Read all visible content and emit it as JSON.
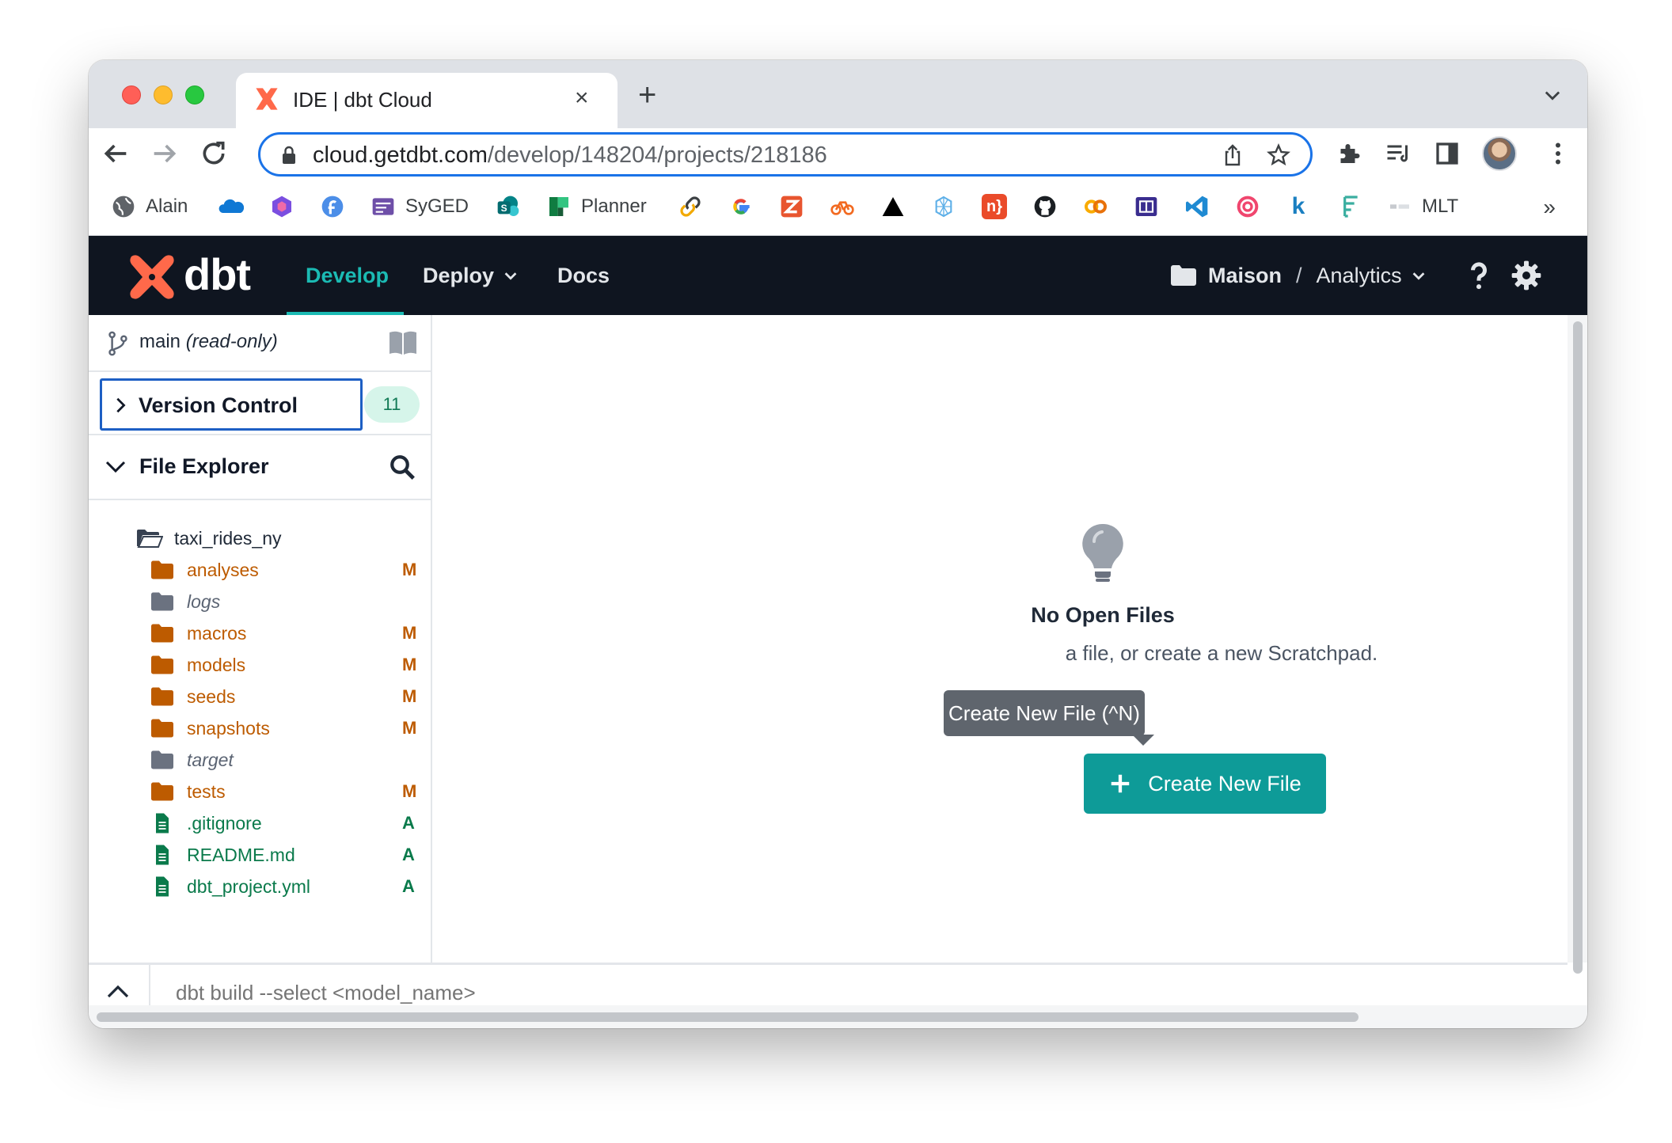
{
  "browser": {
    "tab_title": "IDE | dbt Cloud",
    "tab_close": "×",
    "new_tab": "+",
    "url_host": "cloud.getdbt.com",
    "url_path": "/develop/148204/projects/218186"
  },
  "bookmarks": [
    {
      "label": "Alain",
      "icon": "globe-icon"
    },
    {
      "label": "",
      "icon": "onedrive-icon"
    },
    {
      "label": "",
      "icon": "office-icon"
    },
    {
      "label": "",
      "icon": "f-icon"
    },
    {
      "label": "SyGED",
      "icon": "syged-icon"
    },
    {
      "label": "",
      "icon": "sharepoint-icon"
    },
    {
      "label": "Planner",
      "icon": "planner-icon"
    },
    {
      "label": "",
      "icon": "link-icon"
    },
    {
      "label": "",
      "icon": "google-icon"
    },
    {
      "label": "",
      "icon": "zotero-icon"
    },
    {
      "label": "",
      "icon": "bike-icon"
    },
    {
      "label": "",
      "icon": "triangle-icon"
    },
    {
      "label": "",
      "icon": "brain-icon"
    },
    {
      "label": "",
      "icon": "n-icon"
    },
    {
      "label": "",
      "icon": "github-icon"
    },
    {
      "label": "",
      "icon": "colab-icon"
    },
    {
      "label": "",
      "icon": "app-icon"
    },
    {
      "label": "",
      "icon": "vscode-icon"
    },
    {
      "label": "",
      "icon": "target-icon"
    },
    {
      "label": "",
      "icon": "k-icon"
    },
    {
      "label": "",
      "icon": "tree-icon"
    },
    {
      "label": "",
      "icon": "small-logo-icon"
    },
    {
      "label": "MLT",
      "icon": ""
    }
  ],
  "bookmarks_more": "»",
  "app": {
    "logo_text": "dbt",
    "nav": {
      "develop": "Develop",
      "deploy": "Deploy",
      "docs": "Docs"
    },
    "org": "Maison",
    "crumb_sep": "/",
    "project": "Analytics"
  },
  "sidebar": {
    "branch": "main",
    "branch_mode": "(read-only)",
    "version_control": "Version Control",
    "vc_count": "11",
    "file_explorer": "File Explorer",
    "root": "taxi_rides_ny",
    "items": [
      {
        "name": "analyses",
        "type": "folder",
        "status": "M",
        "state": "modified"
      },
      {
        "name": "logs",
        "type": "folder",
        "status": "",
        "state": "ignored"
      },
      {
        "name": "macros",
        "type": "folder",
        "status": "M",
        "state": "modified"
      },
      {
        "name": "models",
        "type": "folder",
        "status": "M",
        "state": "modified"
      },
      {
        "name": "seeds",
        "type": "folder",
        "status": "M",
        "state": "modified"
      },
      {
        "name": "snapshots",
        "type": "folder",
        "status": "M",
        "state": "modified"
      },
      {
        "name": "target",
        "type": "folder",
        "status": "",
        "state": "ignored"
      },
      {
        "name": "tests",
        "type": "folder",
        "status": "M",
        "state": "modified"
      },
      {
        "name": ".gitignore",
        "type": "file",
        "status": "A",
        "state": "added"
      },
      {
        "name": "README.md",
        "type": "file",
        "status": "A",
        "state": "added"
      },
      {
        "name": "dbt_project.yml",
        "type": "file",
        "status": "A",
        "state": "added"
      }
    ]
  },
  "main": {
    "empty_title": "No Open Files",
    "empty_hint": "a file, or create a new Scratchpad.",
    "tooltip": "Create New File (^N)",
    "create_button": "Create New File"
  },
  "command": {
    "placeholder": "dbt build --select <model_name>"
  },
  "colors": {
    "accent": "#1bbab3",
    "button": "#0e9b98",
    "header": "#0f1520",
    "modified": "#bd5b00",
    "added": "#0a7a4b",
    "focus": "#1d5fc4"
  }
}
